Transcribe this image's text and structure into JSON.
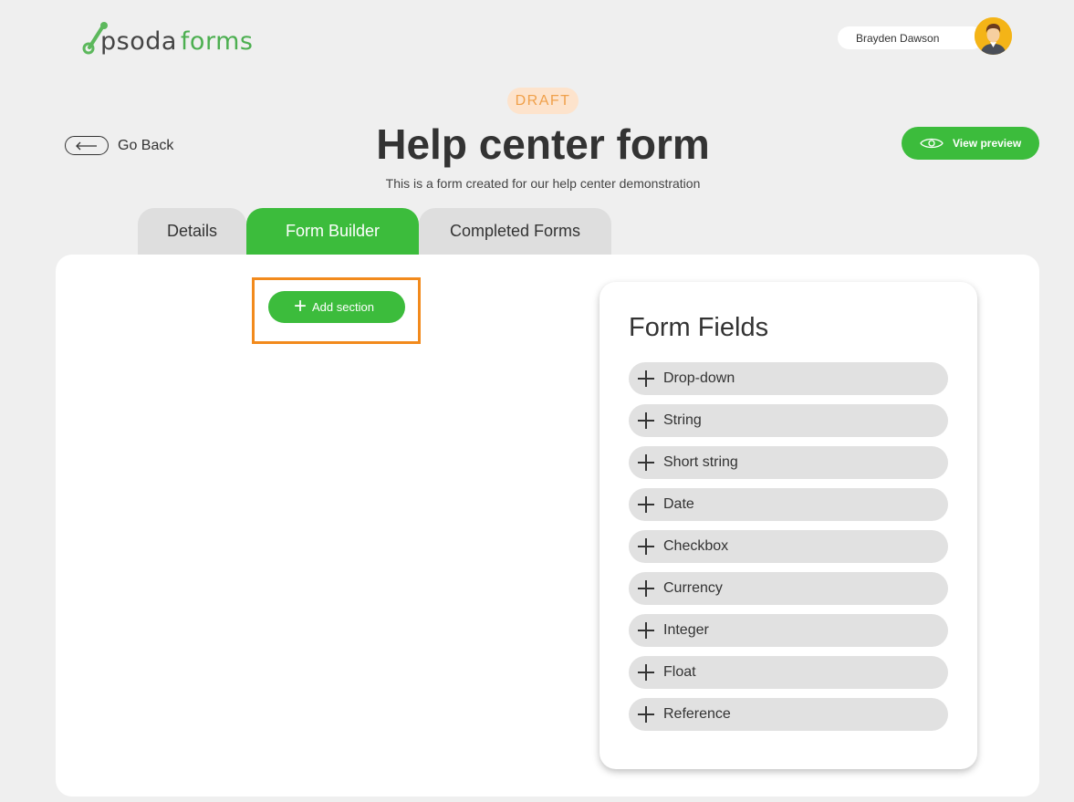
{
  "brand": {
    "word_part1": "psoda",
    "word_part2": "forms"
  },
  "user": {
    "name": "Brayden Dawson"
  },
  "header": {
    "status_badge": "DRAFT",
    "title": "Help center form",
    "subtitle": "This is a form created for our help center demonstration",
    "go_back_label": "Go Back",
    "view_preview_label": "View preview"
  },
  "tabs": [
    {
      "label": "Details"
    },
    {
      "label": "Form Builder"
    },
    {
      "label": "Completed Forms"
    }
  ],
  "builder": {
    "add_section_label": "Add section"
  },
  "form_fields": {
    "title": "Form Fields",
    "items": [
      {
        "label": "Drop-down"
      },
      {
        "label": "String"
      },
      {
        "label": "Short string"
      },
      {
        "label": "Date"
      },
      {
        "label": "Checkbox"
      },
      {
        "label": "Currency"
      },
      {
        "label": "Integer"
      },
      {
        "label": "Float"
      },
      {
        "label": "Reference"
      }
    ]
  },
  "colors": {
    "accent_green": "#3cbc3c",
    "highlight_orange": "#f28a1c",
    "draft_text": "#f0a04a"
  }
}
